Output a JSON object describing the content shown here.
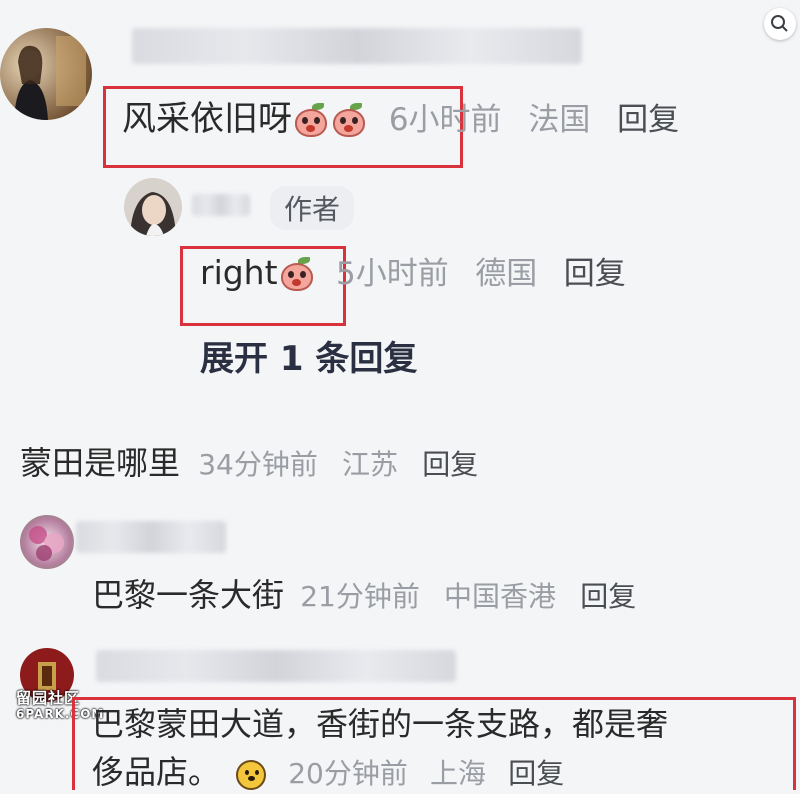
{
  "comments": [
    {
      "text": "风采依旧呀",
      "time": "6小时前",
      "location": "法国",
      "reply_label": "回复"
    },
    {
      "author_tag": "作者",
      "text": "right",
      "time": "5小时前",
      "location": "德国",
      "reply_label": "回复"
    },
    {
      "expand_replies": "展开 1 条回复"
    },
    {
      "text": "蒙田是哪里",
      "time": "34分钟前",
      "location": "江苏",
      "reply_label": "回复"
    },
    {
      "text": "巴黎一条大街",
      "time": "21分钟前",
      "location": "中国香港",
      "reply_label": "回复"
    },
    {
      "text_line1": "巴黎蒙田大道，香街的一条支路，都是奢",
      "text_line2": "侈品店。",
      "time": "20分钟前",
      "location": "上海",
      "reply_label": "回复"
    }
  ],
  "watermark": {
    "line1": "留园社区",
    "line2": "6PARK.COM"
  },
  "icons": {
    "top_right": "image-search-icon",
    "emoji_peach": "peach-emoji-icon",
    "emoji_dog": "dog-emoji-icon"
  },
  "colors": {
    "highlight_box": "#d9323c",
    "meta_text": "#9a9da3",
    "page_bg": "#f4f5f7"
  }
}
